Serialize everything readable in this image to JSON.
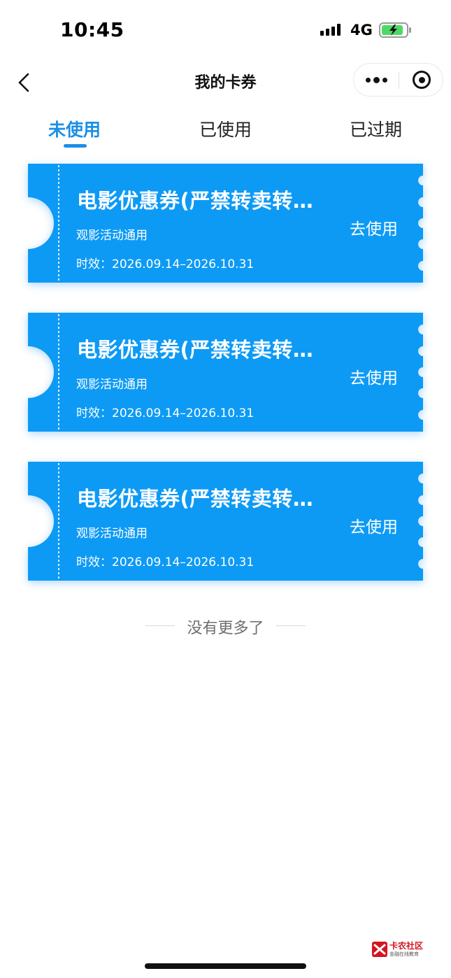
{
  "status_bar": {
    "time": "10:45",
    "network": "4G",
    "battery_color": "#4cd964"
  },
  "nav": {
    "title": "我的卡券",
    "back_icon": "chevron-left-icon",
    "more_icon": "more-dots-icon",
    "close_icon": "target-close-icon"
  },
  "tabs": [
    {
      "label": "未使用",
      "active": true
    },
    {
      "label": "已使用",
      "active": false
    },
    {
      "label": "已过期",
      "active": false
    }
  ],
  "accent_color": "#1b8fe6",
  "coupon_color": "#0d9af5",
  "coupons": [
    {
      "title": "电影优惠券(严禁转卖转…",
      "description": "观影活动通用",
      "validity": "时效：2026.09.14–2026.10.31",
      "action": "去使用"
    },
    {
      "title": "电影优惠券(严禁转卖转…",
      "description": "观影活动通用",
      "validity": "时效：2026.09.14–2026.10.31",
      "action": "去使用"
    },
    {
      "title": "电影优惠券(严禁转卖转…",
      "description": "观影活动通用",
      "validity": "时效：2026.09.14–2026.10.31",
      "action": "去使用"
    }
  ],
  "end_of_list": "没有更多了",
  "watermark": {
    "name": "卡农社区",
    "subtitle": "金融在线教育"
  }
}
